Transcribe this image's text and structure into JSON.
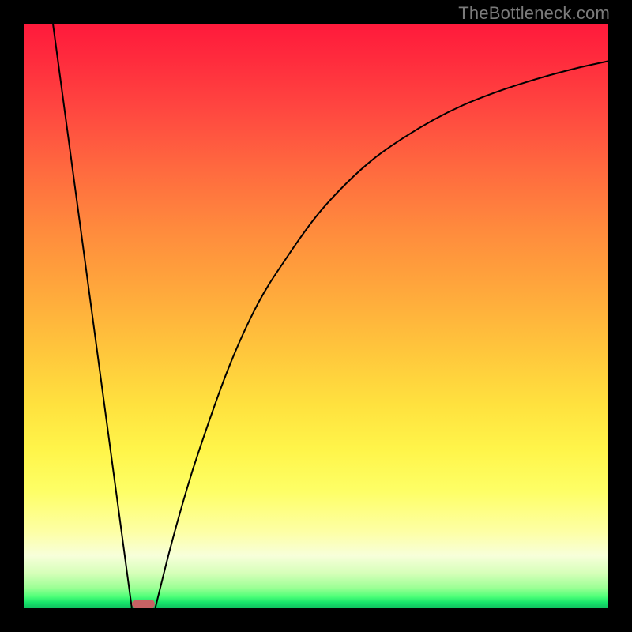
{
  "watermark": "TheBottleneck.com",
  "chart_data": {
    "type": "line",
    "title": "",
    "xlabel": "",
    "ylabel": "",
    "xlim": [
      0,
      100
    ],
    "ylim": [
      0,
      100
    ],
    "grid": false,
    "legend": false,
    "background_gradient": {
      "top": "#ff1a3c",
      "middle": "#ffe13e",
      "bottom": "#0fbf5f",
      "description": "vertical red-to-yellow-to-green gradient"
    },
    "series": [
      {
        "name": "left-line",
        "type": "line",
        "color": "#000000",
        "x": [
          5.0,
          18.5
        ],
        "y": [
          100,
          0
        ]
      },
      {
        "name": "right-curve",
        "type": "line",
        "color": "#000000",
        "x": [
          22.5,
          25,
          27.5,
          30,
          35,
          40,
          45,
          50,
          55,
          60,
          65,
          70,
          75,
          80,
          85,
          90,
          95,
          100
        ],
        "y": [
          0,
          10,
          19,
          27,
          41,
          52,
          60,
          67,
          72.5,
          77,
          80.5,
          83.5,
          86,
          88,
          89.7,
          91.2,
          92.5,
          93.6
        ]
      }
    ],
    "marker": {
      "shape": "rounded-rect",
      "color": "#c76264",
      "x_range": [
        18.5,
        22.5
      ],
      "y": 0
    }
  }
}
